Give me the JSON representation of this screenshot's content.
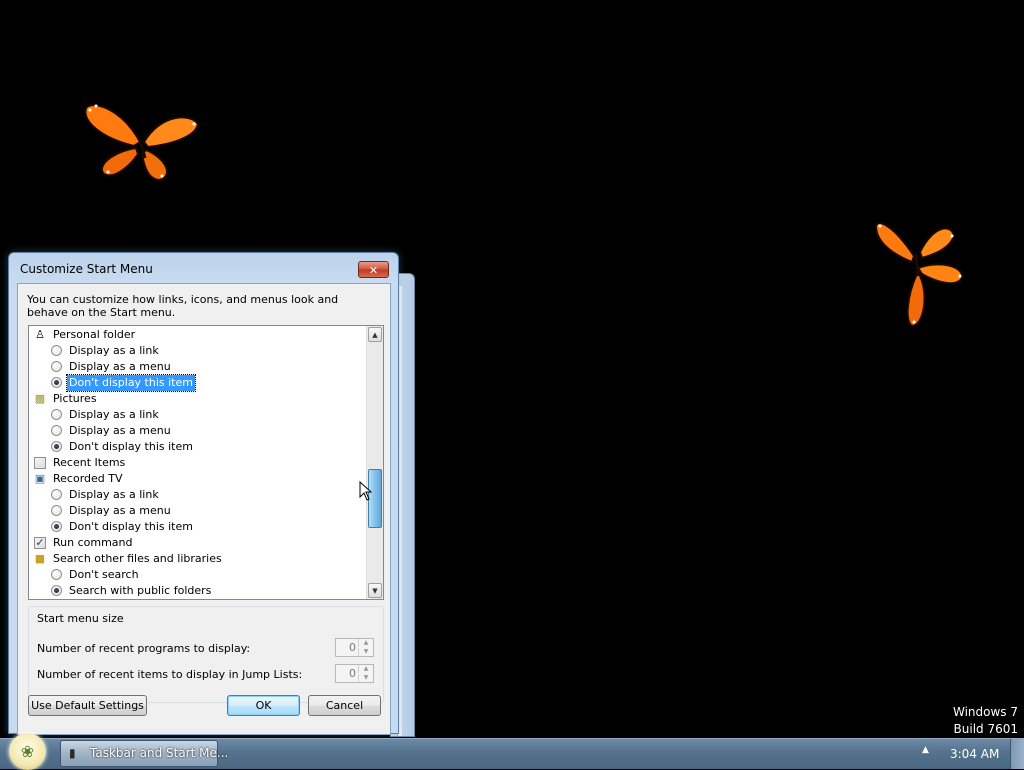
{
  "colors": {
    "desktop": "#000000",
    "selection": "#3399ff",
    "butterfly": "#ff8a1a",
    "close_button": "#c8452e"
  },
  "dialog": {
    "title": "Customize Start Menu",
    "close_glyph": "✕",
    "intro": "You can customize how links, icons, and menus look and behave on the Start menu.",
    "items": [
      {
        "type": "category",
        "icon": "personal-folder-icon",
        "label": "Personal folder"
      },
      {
        "type": "radio",
        "label": "Display as a link",
        "checked": false
      },
      {
        "type": "radio",
        "label": "Display as a menu",
        "checked": false
      },
      {
        "type": "radio",
        "label": "Don't display this item",
        "checked": true,
        "selected": true
      },
      {
        "type": "category",
        "icon": "pictures-icon",
        "label": "Pictures"
      },
      {
        "type": "radio",
        "label": "Display as a link",
        "checked": false
      },
      {
        "type": "radio",
        "label": "Display as a menu",
        "checked": false
      },
      {
        "type": "radio",
        "label": "Don't display this item",
        "checked": true
      },
      {
        "type": "checkbox",
        "label": "Recent Items",
        "checked": false
      },
      {
        "type": "category",
        "icon": "recorded-tv-icon",
        "label": "Recorded TV"
      },
      {
        "type": "radio",
        "label": "Display as a link",
        "checked": false
      },
      {
        "type": "radio",
        "label": "Display as a menu",
        "checked": false
      },
      {
        "type": "radio",
        "label": "Don't display this item",
        "checked": true
      },
      {
        "type": "checkbox",
        "label": "Run command",
        "checked": true
      },
      {
        "type": "category",
        "icon": "search-libraries-icon",
        "label": "Search other files and libraries"
      },
      {
        "type": "radio",
        "label": "Don't search",
        "checked": false
      },
      {
        "type": "radio",
        "label": "Search with public folders",
        "checked": true
      }
    ],
    "size_group": {
      "title": "Start menu size",
      "recent_programs_label": "Number of recent programs to display:",
      "recent_programs_value": "0",
      "jump_list_label": "Number of recent items to display in Jump Lists:",
      "jump_list_value": "0"
    },
    "buttons": {
      "defaults": "Use Default Settings",
      "ok": "OK",
      "cancel": "Cancel"
    }
  },
  "watermark": {
    "line1": "Windows 7",
    "line2": "Build 7601"
  },
  "taskbar": {
    "task_label": "Taskbar and Start Me...",
    "clock": "3:04 AM",
    "tray_arrow": "▲"
  }
}
